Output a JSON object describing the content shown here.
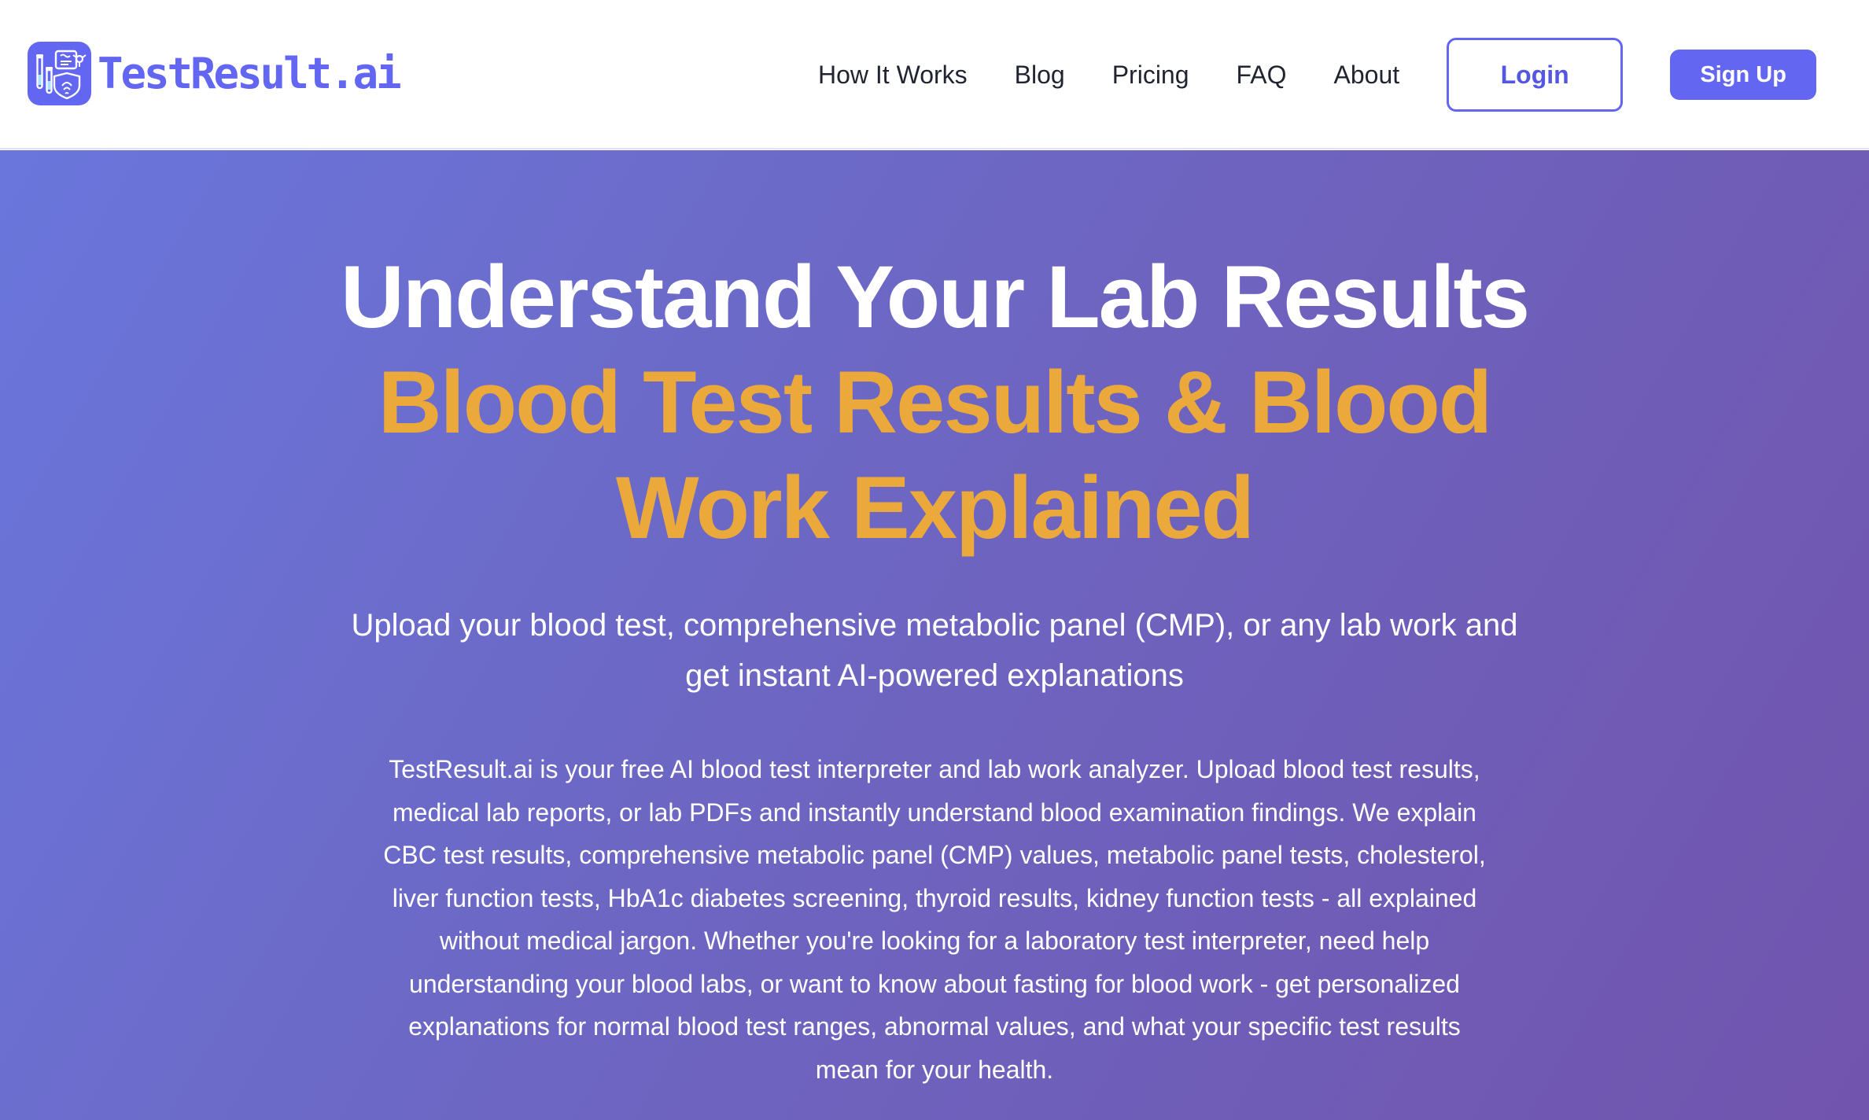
{
  "header": {
    "logo_text": "TestResult.ai",
    "logo_icon": "lab-tools-icon",
    "nav": {
      "how_it_works": "How It Works",
      "blog": "Blog",
      "pricing": "Pricing",
      "faq": "FAQ",
      "about": "About"
    },
    "login_label": "Login",
    "signup_label": "Sign Up"
  },
  "hero": {
    "title": "Understand Your Lab Results",
    "highlight": "Blood Test Results & Blood Work Explained",
    "subtitle": "Upload your blood test, comprehensive metabolic panel (CMP), or any lab work and get instant AI-powered explanations",
    "description": "TestResult.ai is your free AI blood test interpreter and lab work analyzer. Upload blood test results, medical lab reports, or lab PDFs and instantly understand blood examination findings. We explain CBC test results, comprehensive metabolic panel (CMP) values, metabolic panel tests, cholesterol, liver function tests, HbA1c diabetes screening, thyroid results, kidney function tests - all explained without medical jargon. Whether you're looking for a laboratory test interpreter, need help understanding your blood labs, or want to know about fasting for blood work - get personalized explanations for normal blood test ranges, abnormal values, and what your specific test results mean for your health."
  },
  "colors": {
    "brand": "#6366f1",
    "highlight": "#eaa93a",
    "hero_gradient_start": "#6a76dc",
    "hero_gradient_end": "#7154ad"
  }
}
